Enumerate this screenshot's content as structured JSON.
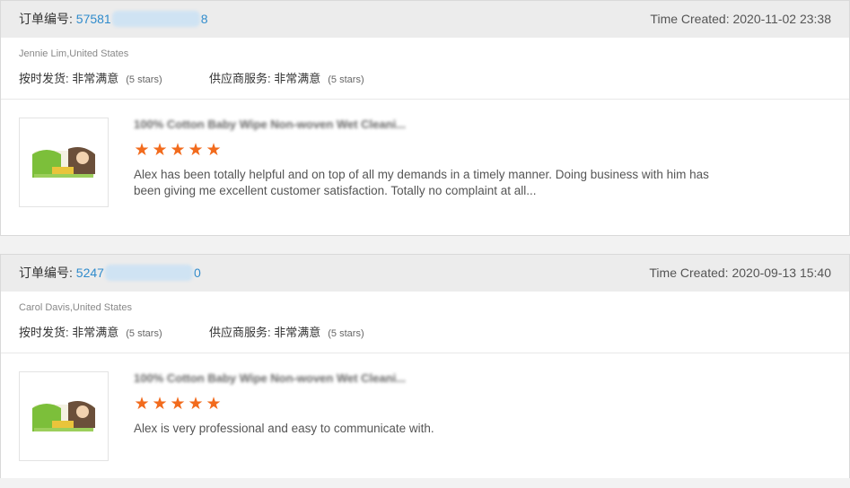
{
  "orders": [
    {
      "order_label": "订单编号:",
      "order_prefix": "57581",
      "order_suffix": "8",
      "time_created": "Time Created: 2020-11-02 23:38",
      "buyer": "Jennie Lim,United States",
      "ontime_label": "按时发货:",
      "ontime_value": "非常满意",
      "ontime_stars": "(5 stars)",
      "service_label": "供应商服务:",
      "service_value": "非常满意",
      "service_stars": "(5 stars)",
      "product_title": "100% Cotton Baby Wipe Non-woven Wet Cleani...",
      "rating": 5,
      "comment": "Alex has been totally helpful and on top of all my demands in a timely manner.  Doing business with him has been giving me excellent customer satisfaction.  Totally no complaint at all..."
    },
    {
      "order_label": "订单编号:",
      "order_prefix": "5247",
      "order_suffix": "0",
      "time_created": "Time Created: 2020-09-13 15:40",
      "buyer": "Carol Davis,United States",
      "ontime_label": "按时发货:",
      "ontime_value": "非常满意",
      "ontime_stars": "(5 stars)",
      "service_label": "供应商服务:",
      "service_value": "非常满意",
      "service_stars": "(5 stars)",
      "product_title": "100% Cotton Baby Wipe Non-woven Wet Cleani...",
      "rating": 5,
      "comment": "Alex is very professional and easy to communicate with."
    }
  ],
  "colors": {
    "link": "#2f8bcc",
    "star": "#f26b1d",
    "header_bg": "#ececec"
  },
  "icons": {
    "star": "star-icon",
    "thumbnail": "product-thumbnail"
  }
}
